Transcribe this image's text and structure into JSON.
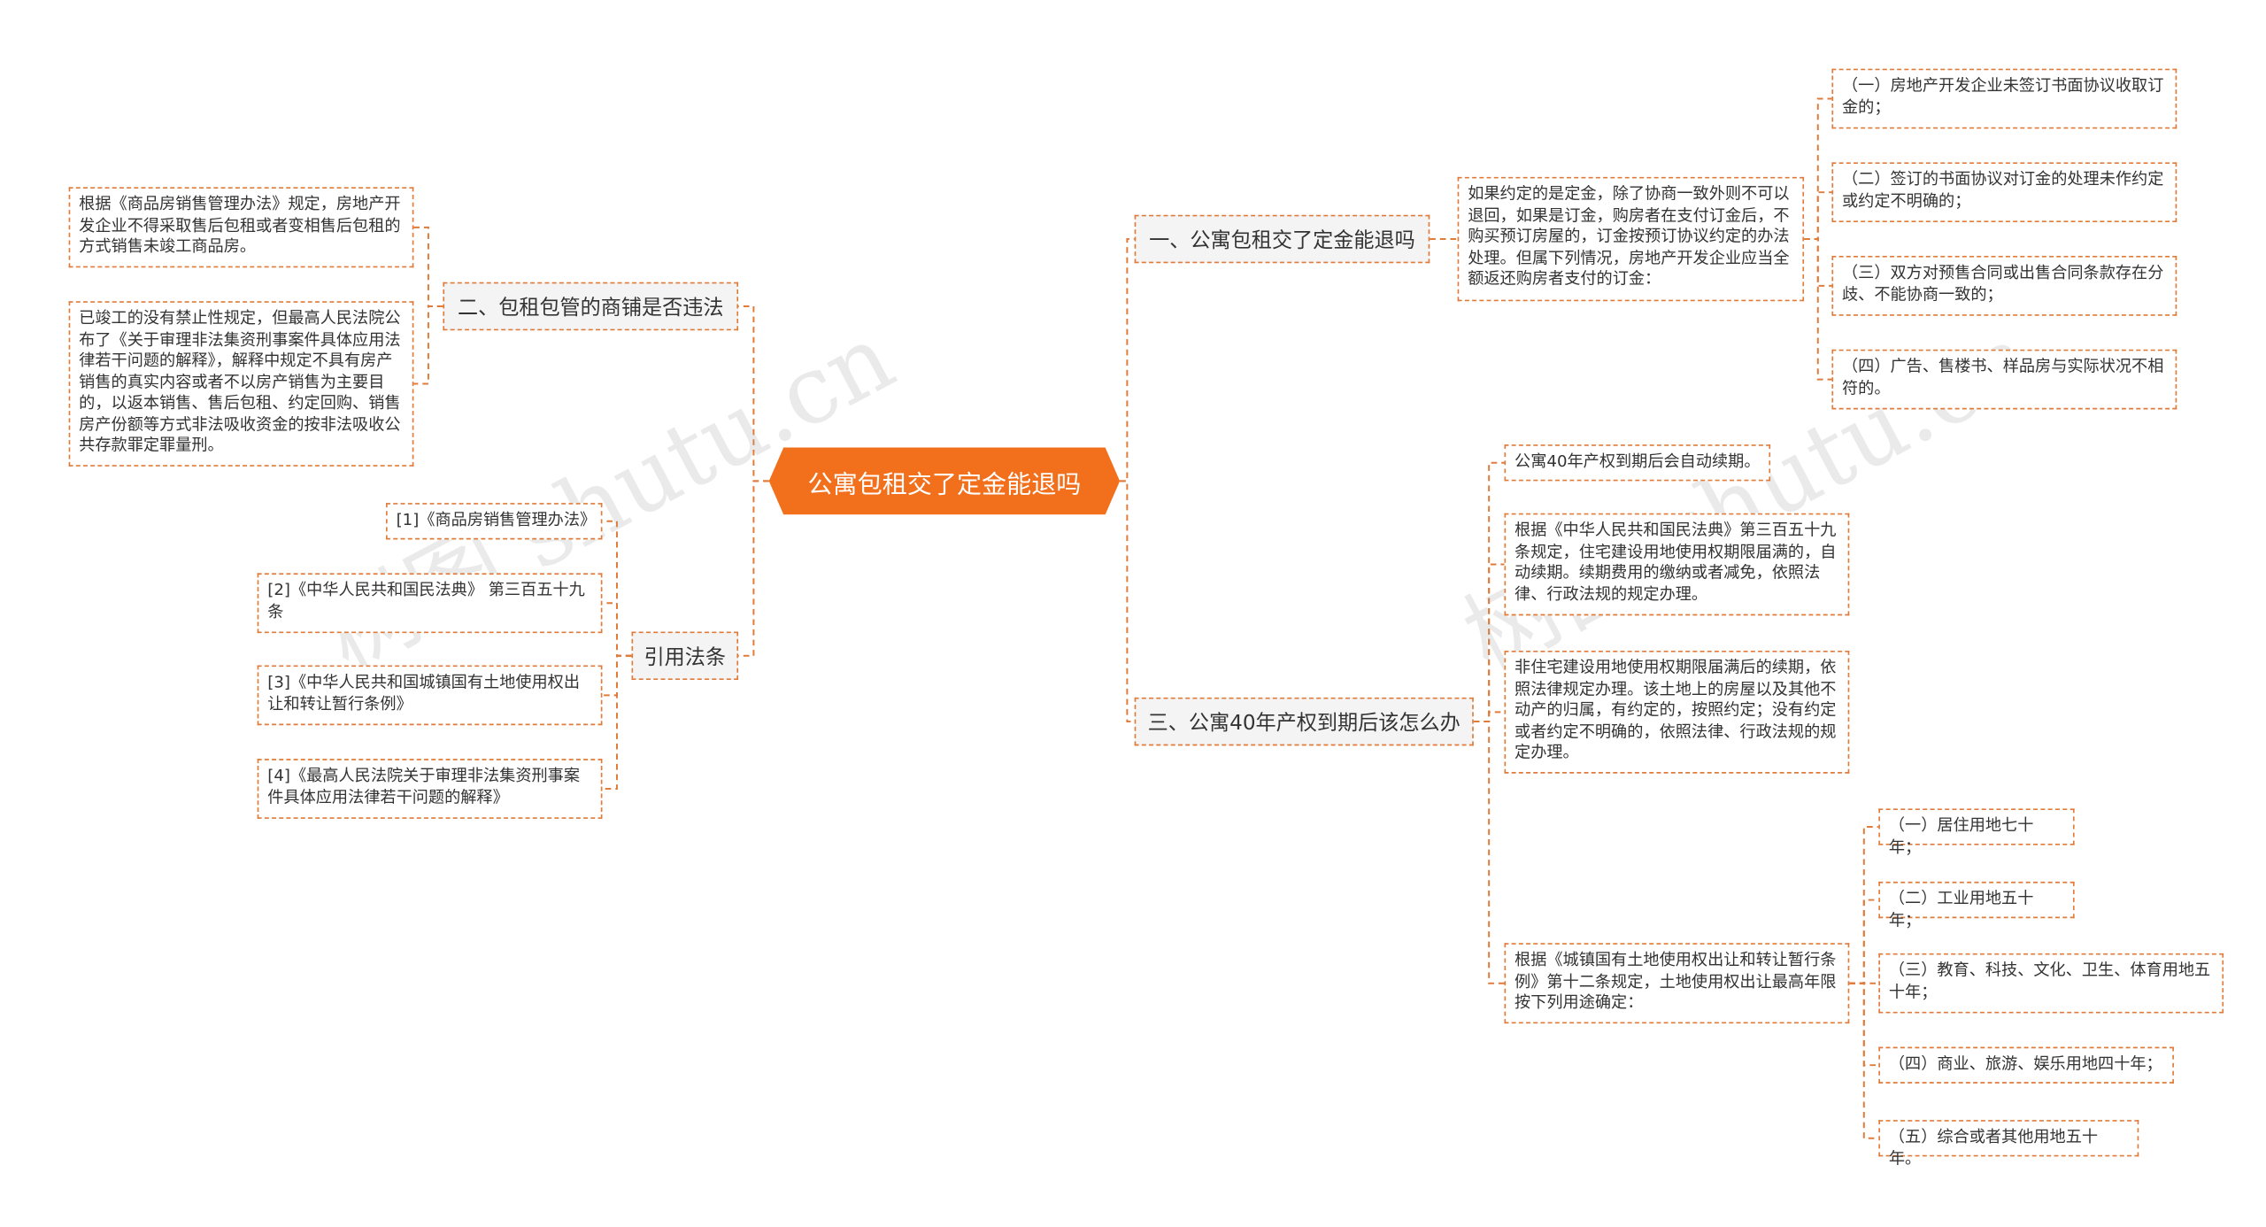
{
  "root": "公寓包租交了定金能退吗",
  "branches": {
    "b1": {
      "title": "一、公寓包租交了定金能退吗",
      "detail": "如果约定的是定金，除了协商一致外则不可以退回，如果是订金，购房者在支付订金后，不购买预订房屋的，订金按预订协议约定的办法处理。但属下列情况，房地产开发企业应当全额返还购房者支付的订金：",
      "items": [
        "（一）房地产开发企业未签订书面协议收取订金的；",
        "（二）签订的书面协议对订金的处理未作约定或约定不明确的；",
        "（三）双方对预售合同或出售合同条款存在分歧、不能协商一致的；",
        "（四）广告、售楼书、样品房与实际状况不相符的。"
      ]
    },
    "b2": {
      "title": "二、包租包管的商铺是否违法",
      "items": [
        "根据《商品房销售管理办法》规定，房地产开发企业不得采取售后包租或者变相售后包租的方式销售未竣工商品房。",
        "已竣工的没有禁止性规定，但最高人民法院公布了《关于审理非法集资刑事案件具体应用法律若干问题的解释》，解释中规定不具有房产销售的真实内容或者不以房产销售为主要目的，以返本销售、售后包租、约定回购、销售房产份额等方式非法吸收资金的按非法吸收公共存款罪定罪量刑。"
      ]
    },
    "b3": {
      "title": "三、公寓40年产权到期后该怎么办",
      "items": [
        "公寓40年产权到期后会自动续期。",
        "根据《中华人民共和国民法典》第三百五十九条规定，住宅建设用地使用权期限届满的，自动续期。续期费用的缴纳或者减免，依照法律、行政法规的规定办理。",
        "非住宅建设用地使用权期限届满后的续期，依照法律规定办理。该土地上的房屋以及其他不动产的归属，有约定的，按照约定；没有约定或者约定不明确的，依照法律、行政法规的规定办理。",
        "根据《城镇国有土地使用权出让和转让暂行条例》第十二条规定，土地使用权出让最高年限按下列用途确定："
      ],
      "sub_items": [
        "（一）居住用地七十年；",
        "（二）工业用地五十年；",
        "（三）教育、科技、文化、卫生、体育用地五十年；",
        "（四）商业、旅游、娱乐用地四十年；",
        "（五）综合或者其他用地五十年。"
      ]
    },
    "b4": {
      "title": "引用法条",
      "items": [
        "[1]《商品房销售管理办法》",
        "[2]《中华人民共和国民法典》 第三百五十九条",
        "[3]《中华人民共和国城镇国有土地使用权出让和转让暂行条例》",
        "[4]《最高人民法院关于审理非法集资刑事案件具体应用法律若干问题的解释》"
      ]
    }
  },
  "watermark": "树图 shutu.cn",
  "colors": {
    "accent": "#f26f1c",
    "line": "#e07b3a",
    "node_bg": "#f4f4f4"
  }
}
